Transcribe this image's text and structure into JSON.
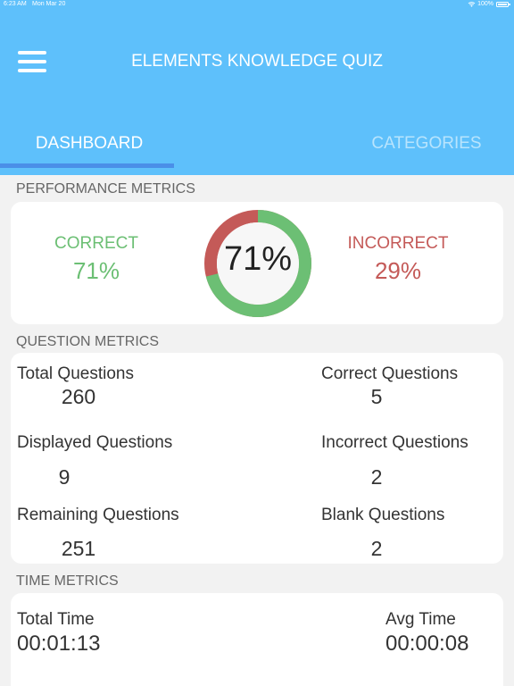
{
  "status_bar": {
    "time": "6:23 AM",
    "date": "Mon Mar 20",
    "battery": "100%"
  },
  "header": {
    "title": "ELEMENTS KNOWLEDGE QUIZ",
    "menu_icon": "hamburger-menu-icon",
    "background_color": "#5ec0fb"
  },
  "tabs": [
    {
      "label": "DASHBOARD",
      "active": true
    },
    {
      "label": "CATEGORIES",
      "active": false
    }
  ],
  "performance": {
    "section_title": "PERFORMANCE METRICS",
    "correct_label": "CORRECT",
    "correct_value": "71%",
    "incorrect_label": "INCORRECT",
    "incorrect_value": "29%",
    "center_value": "71%",
    "correct_fraction": 0.71,
    "incorrect_fraction": 0.29,
    "correct_color": "#6cbf74",
    "incorrect_color": "#c45a58"
  },
  "questions": {
    "section_title": "QUESTION METRICS",
    "total_label": "Total Questions",
    "total_value": "260",
    "correct_label": "Correct Questions",
    "correct_value": "5",
    "displayed_label": "Displayed Questions",
    "displayed_value": "9",
    "incorrect_label": "Incorrect Questions",
    "incorrect_value": "2",
    "remaining_label": "Remaining Questions",
    "remaining_value": "251",
    "blank_label": "Blank Questions",
    "blank_value": "2"
  },
  "time": {
    "section_title": "TIME METRICS",
    "total_label": "Total Time",
    "total_value": "00:01:13",
    "avg_label": "Avg Time",
    "avg_value": "00:00:08"
  }
}
